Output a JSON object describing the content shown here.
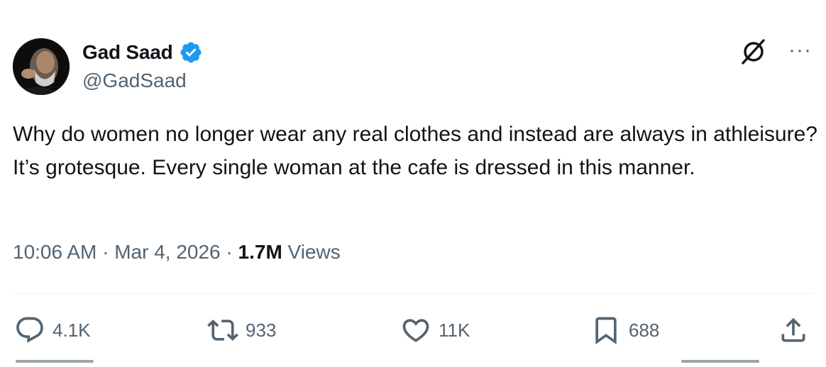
{
  "author": {
    "name": "Gad Saad",
    "handle": "@GadSaad",
    "verified": true
  },
  "icons": {
    "verified": "verified-badge-icon",
    "grok": "grok-icon",
    "more": "more-options-icon",
    "reply": "reply-icon",
    "repost": "repost-icon",
    "like": "like-icon",
    "bookmark": "bookmark-icon",
    "share": "share-icon"
  },
  "colors": {
    "text_primary": "#0f1419",
    "text_secondary": "#536471",
    "verified_blue": "#1d9bf0",
    "divider": "#eff3f4"
  },
  "tweet": {
    "text": "Why do women no longer wear any real clothes and instead are always in athleisure?  It’s grotesque. Every single woman at the cafe is dressed in this manner.",
    "time": "10:06 AM",
    "separator": " · ",
    "date": "Mar 4, 2026",
    "views_count": "1.7M",
    "views_label": " Views"
  },
  "stats": {
    "replies": "4.1K",
    "reposts": "933",
    "likes": "11K",
    "bookmarks": "688"
  }
}
